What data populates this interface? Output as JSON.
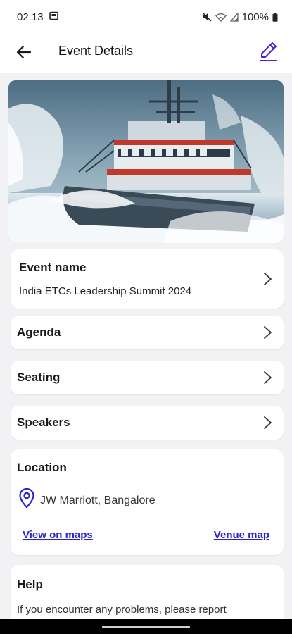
{
  "status_bar": {
    "time": "02:13",
    "battery": "100%",
    "icons": [
      "screenshot-icon",
      "mute-icon",
      "wifi-icon",
      "signal-icon",
      "battery-icon"
    ]
  },
  "app_bar": {
    "title": "Event Details",
    "back_icon": "arrow-left-icon",
    "edit_icon": "pencil-icon",
    "accent_color": "#4b1fd6"
  },
  "hero_image": {
    "description": "Ship in stormy sea"
  },
  "event": {
    "label": "Event name",
    "name": "India ETCs Leadership Summit 2024"
  },
  "sections": {
    "agenda": "Agenda",
    "seating": "Seating",
    "speakers": "Speakers"
  },
  "location": {
    "label": "Location",
    "venue": "JW Marriott, Bangalore",
    "view_on_maps": "View on maps",
    "venue_map": "Venue map",
    "link_color": "#2b22c8"
  },
  "help": {
    "label": "Help",
    "text": "If you encounter any problems, please report"
  }
}
